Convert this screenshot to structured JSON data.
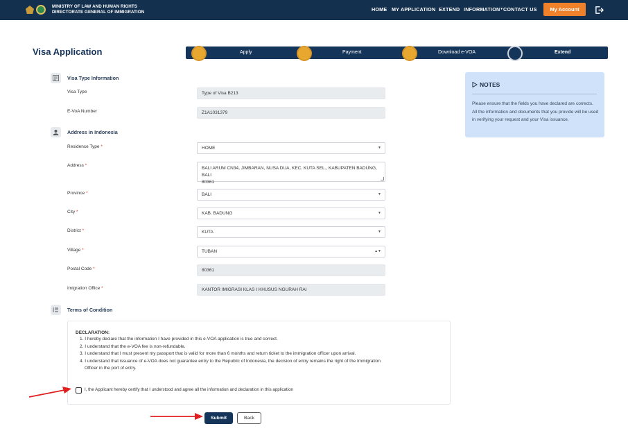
{
  "header": {
    "org_line1": "MINISTRY OF LAW AND HUMAN RIGHTS",
    "org_line2": "DIRECTORATE GENERAL OF IMMIGRATION",
    "nav": [
      "HOME",
      "MY APPLICATION",
      "EXTEND",
      "INFORMATION",
      "CONTACT US"
    ],
    "account_button": "My Account"
  },
  "page": {
    "title": "Visa Application"
  },
  "stepper": {
    "steps": [
      "Apply",
      "Payment",
      "Download e-VOA",
      "Extend"
    ],
    "current": "Extend"
  },
  "visa_type": {
    "section_title": "Visa Type Information",
    "visa_type_label": "Visa Type",
    "visa_type_value": "Type of Visa B213",
    "evoa_label": "E-VoA Number",
    "evoa_value": "Z1A1031379"
  },
  "address": {
    "section_title": "Address in Indonesia",
    "residence_type_label": "Residence Type",
    "residence_type_value": "HOME",
    "address_label": "Address",
    "address_value_line1": "BALI ARUM CN34, JIMBARAN, NUSA DUA, KEC. KUTA SEL., KABUPATEN BADUNG, BALI",
    "address_value_line2": "80361",
    "province_label": "Province",
    "province_value": "BALI",
    "city_label": "City",
    "city_value": "KAB. BADUNG",
    "district_label": "District",
    "district_value": "KUTA",
    "village_label": "Village",
    "village_value": "TUBAN",
    "postal_label": "Postal Code",
    "postal_value": "80361",
    "office_label": "Imigration Office",
    "office_value": "KANTOR IMIGRASI KLAS I KHUSUS NGURAH RAI",
    "required_mark": "*"
  },
  "terms": {
    "section_title": "Terms of Condition",
    "declaration_title": "DECLARATION:",
    "items": [
      "1. I hereby declare that the information I have provided in this e-VOA application is true and correct.",
      "2. I understand that the e-VOA fee is non-refundable.",
      "3. I understand that I must present my passport that is valid for more than 6 months and return ticket to the immigration officer upon arrival.",
      "4. I understand that issuance of e-VOA does not guarantee entry to the Republic of Indonesia, the decision of entry remains the right of the Immigration",
      "Officer in the port of entry."
    ],
    "agree_label": "I, the Applicant hereby certify that I understood and agree all the information and declaration in this application",
    "agree_checked": false
  },
  "notes": {
    "title": "NOTES",
    "text": "Please ensure that the fields you have declared are corrects. All the information and documents that you provide will be used in verifying your request and your Visa issuance."
  },
  "actions": {
    "submit": "Submit",
    "back": "Back"
  },
  "colors": {
    "navy": "#14345a",
    "accent": "#f0812b",
    "step_done": "#e8a830",
    "notes_bg": "#cfe2fa",
    "annotation_arrow": "#e02020"
  }
}
